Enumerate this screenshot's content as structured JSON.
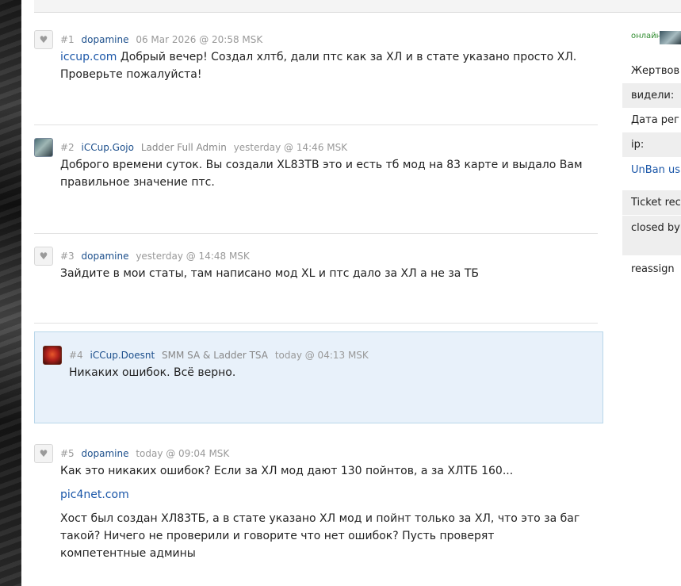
{
  "posts": [
    {
      "num": "#1",
      "author": "dopamine",
      "rank": "",
      "date": "06 Mar 2026 @ 20:58 MSK",
      "link_prefix": "iccup.com",
      "text": " Добрый вечер! Создал хлтб, дали птс как за ХЛ и в стате указано просто ХЛ. Проверьте пожалуйста!"
    },
    {
      "num": "#2",
      "author": "iCCup.Gojo",
      "rank": "Ladder Full Admin",
      "date": "yesterday @ 14:46 MSK",
      "text": "Доброго времени суток. Вы создали XL83TB это и есть тб мод на 83 карте и выдало Вам правильное значение птс."
    },
    {
      "num": "#3",
      "author": "dopamine",
      "rank": "",
      "date": "yesterday @ 14:48 MSK",
      "text": "Зайдите в мои статы, там написано мод XL и птс дало за ХЛ а не за ТБ"
    },
    {
      "num": "#4",
      "author": "iCCup.Doesnt",
      "rank": "SMM SA & Ladder TSA",
      "date": "today @ 04:13 MSK",
      "text": "Никаких ошибок. Всё верно."
    },
    {
      "num": "#5",
      "author": "dopamine",
      "rank": "",
      "date": "today @ 09:04 MSK",
      "text_1": "Как это никаких ошибок? Если за ХЛ мод дают 130 пойнтов, а за ХЛТБ 160...",
      "link": "pic4net.com",
      "text_2": "Хост был создан ХЛ83ТБ, а в стате указано ХЛ мод и пойнт только за ХЛ, что это за баг такой? Ничего не проверили и говорите что нет ошибок? Пусть проверят компетентные админы"
    }
  ],
  "sidebar": {
    "online": "онлайн",
    "rows": [
      "Жертвов",
      "видели:",
      "Дата рег",
      "ip:",
      "UnBan us",
      "Ticket rec",
      "closed by",
      "reassign"
    ]
  },
  "colors": {
    "author": "#1c4f8c",
    "link": "#1a56a8",
    "highlight": "#e8f1fa",
    "online": "#2e8b2e"
  }
}
